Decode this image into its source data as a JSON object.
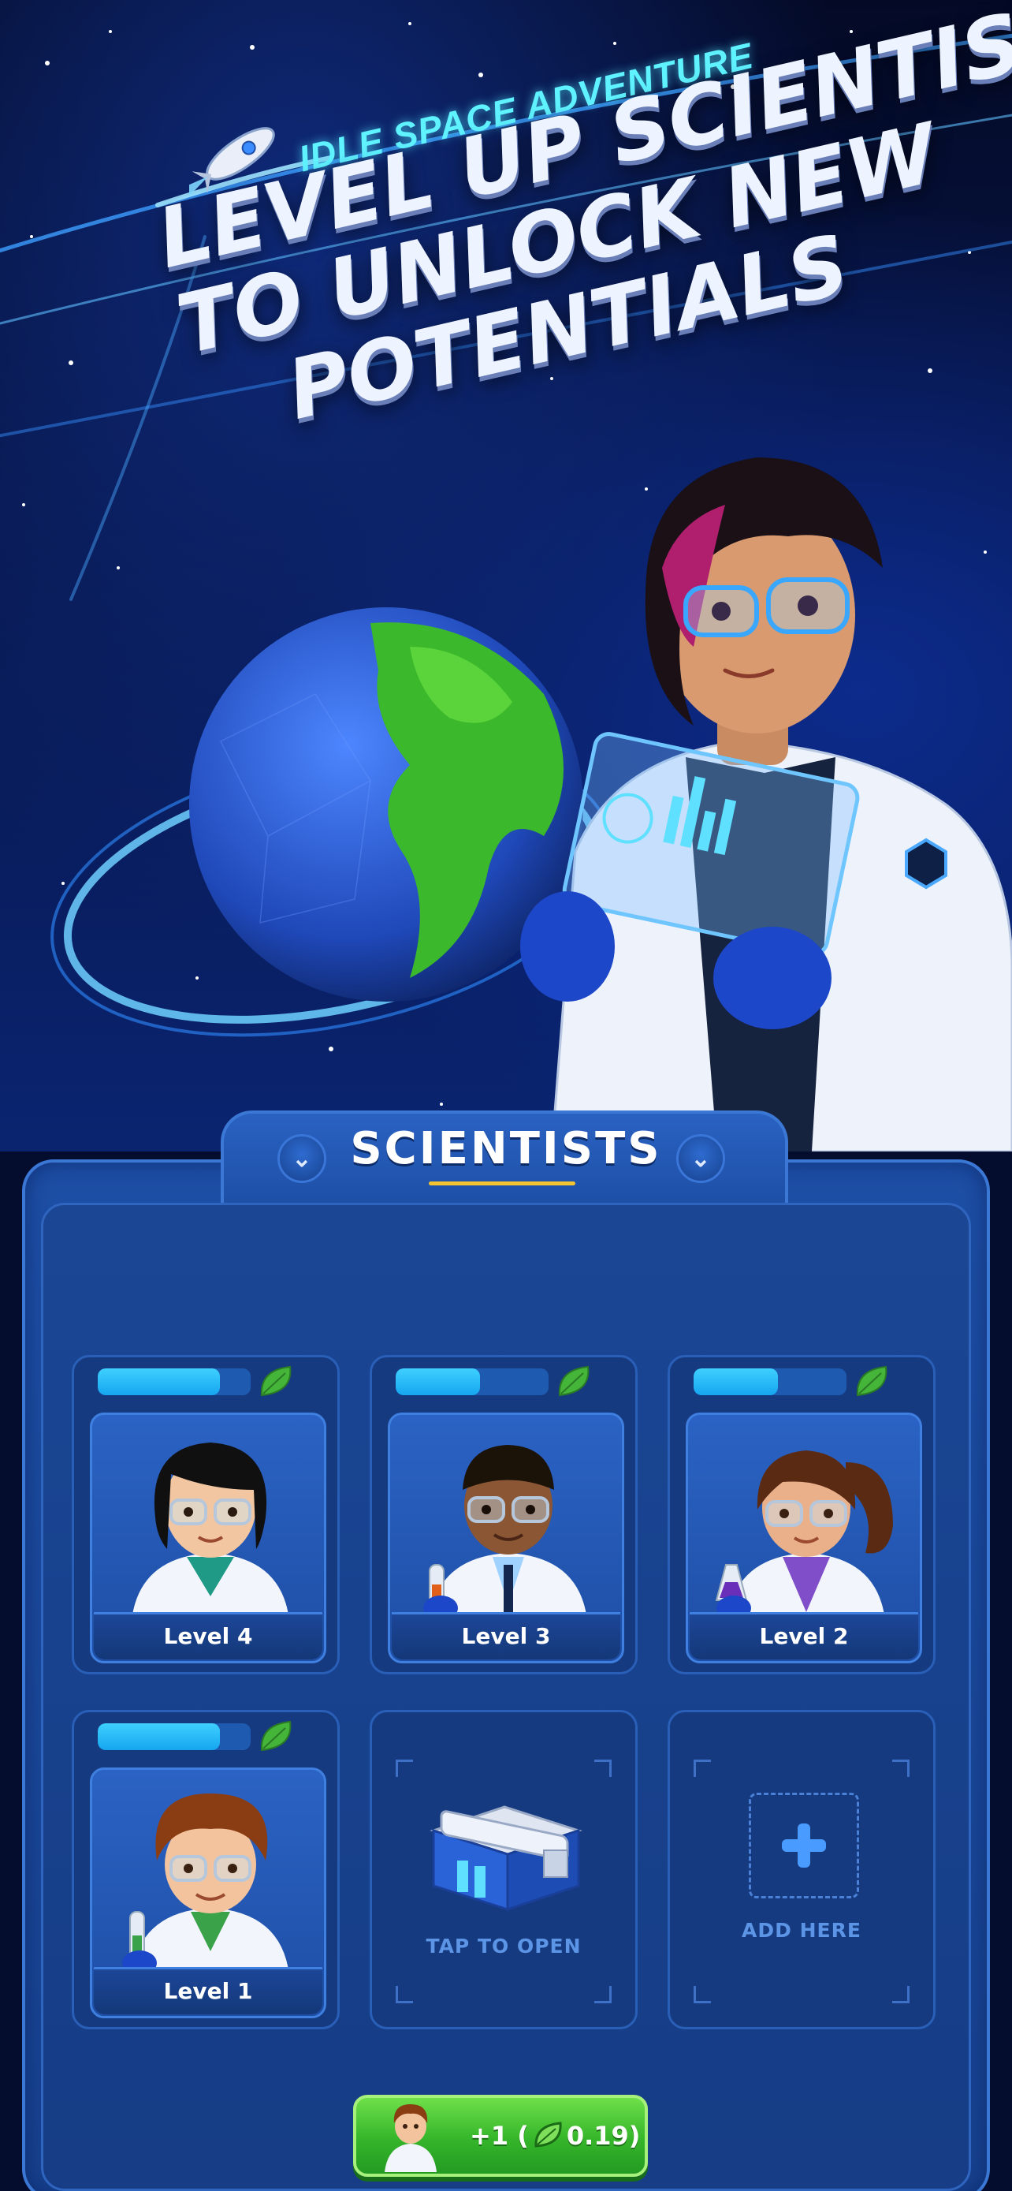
{
  "hero": {
    "subtitle": "IDLE SPACE ADVENTURE",
    "headline_lines": [
      "LEVEL UP SCIENTISTS",
      "TO UNLOCK NEW",
      "POTENTIALS"
    ]
  },
  "panel": {
    "title": "SCIENTISTS"
  },
  "scientists": [
    {
      "level_label": "Level 4",
      "progress": 0.8,
      "hair": "#101010",
      "skin": "#f2c6a0",
      "shirt": "#1e9a86"
    },
    {
      "level_label": "Level 3",
      "progress": 0.55,
      "hair": "#1b1208",
      "skin": "#8a5634",
      "shirt": "#ffffff"
    },
    {
      "level_label": "Level 2",
      "progress": 0.55,
      "hair": "#5a2a12",
      "skin": "#e9b08a",
      "shirt": "#7f4ec8"
    },
    {
      "level_label": "Level 1",
      "progress": 0.8,
      "hair": "#8a3c12",
      "skin": "#f3c39e",
      "shirt": "#3aa34a"
    }
  ],
  "slots": {
    "chest_label": "TAP TO OPEN",
    "add_label": "ADD HERE"
  },
  "hire_button": {
    "label": "+1 (",
    "cost": "0.19)"
  },
  "colors": {
    "accent_cyan": "#5ff2ff",
    "progress_fill": "#15a6f0",
    "leaf_green": "#45b53a",
    "button_green": "#35b52a",
    "underline_gold": "#f5c531"
  },
  "icons": [
    "rocket-icon",
    "leaf-icon",
    "chevron-down-icon",
    "plus-icon",
    "chest-icon"
  ]
}
